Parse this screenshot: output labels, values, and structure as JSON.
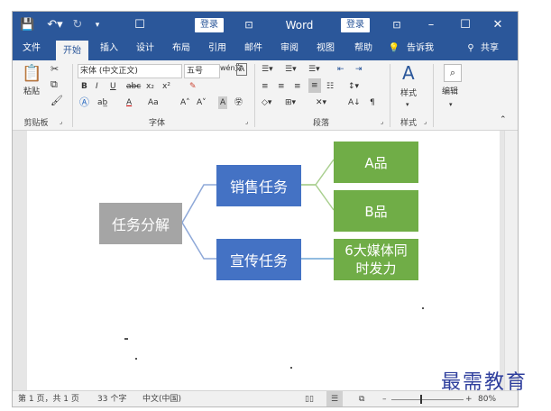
{
  "titlebar": {
    "save_icon": "save-icon",
    "undo_icon": "undo-icon",
    "redo_icon": "redo-icon",
    "login_label_1": "登录",
    "app_name": "Word",
    "login_label_2": "登录"
  },
  "tabs": [
    "文件",
    "开始",
    "插入",
    "设计",
    "布局",
    "引用",
    "邮件",
    "审阅",
    "视图",
    "帮助",
    "告诉我",
    "共享"
  ],
  "ribbon": {
    "paste_label": "粘贴",
    "clipboard_group": "剪贴板",
    "font_name": "宋体 (中文正文)",
    "font_size": "五号",
    "font_group": "字体",
    "paragraph_group": "段落",
    "styles_label": "样式",
    "styles_group": "样式",
    "edit_label": "编辑",
    "bold": "B",
    "italic": "I",
    "underline": "U",
    "strike": "abc",
    "subscript": "x₂",
    "superscript": "x²",
    "font_color": "A",
    "change_case": "Aa",
    "grow": "A˄",
    "shrink": "A˅",
    "char_shade": "A",
    "enclose": "㊫",
    "wen": "wén文"
  },
  "diagram": {
    "root": "任务分解",
    "branches": [
      {
        "label": "销售任务",
        "children": [
          "A品",
          "B品"
        ]
      },
      {
        "label": "宣传任务",
        "children": [
          "6大媒体同时发力"
        ]
      }
    ]
  },
  "colors": {
    "title_bar": "#2b579a",
    "root_node": "#a5a5a5",
    "branch_node": "#4472c4",
    "leaf_node": "#70ad47",
    "connector_upper": "#a9cf8f",
    "connector_lower": "#6fa5d6"
  },
  "statusbar": {
    "pages": "第 1 页，共 1 页",
    "words": "33 个字",
    "language": "中文(中国)",
    "zoom": "80%"
  },
  "watermark": "最需教育"
}
